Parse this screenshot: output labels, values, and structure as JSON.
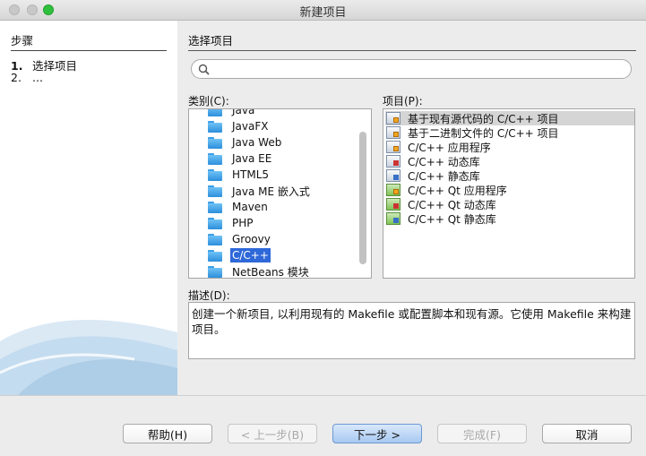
{
  "window": {
    "title": "新建项目"
  },
  "steps": {
    "header": "步骤",
    "items": [
      {
        "num": "1.",
        "label": "选择项目"
      },
      {
        "num": "2.",
        "label": "..."
      }
    ]
  },
  "main": {
    "header": "选择项目",
    "search": {
      "value": "",
      "placeholder": ""
    },
    "categories_label": "类别(C):",
    "projects_label": "项目(P):",
    "categories": [
      "Java",
      "JavaFX",
      "Java Web",
      "Java EE",
      "HTML5",
      "Java ME 嵌入式",
      "Maven",
      "PHP",
      "Groovy",
      "C/C++",
      "NetBeans 模块"
    ],
    "selected_category": "C/C++",
    "projects": [
      {
        "label": "基于现有源代码的 C/C++ 项目",
        "icon": "cpp-project-icon",
        "selected": true
      },
      {
        "label": "基于二进制文件的 C/C++ 项目",
        "icon": "cpp-project-icon"
      },
      {
        "label": "C/C++ 应用程序",
        "icon": "cpp-application-icon"
      },
      {
        "label": "C/C++ 动态库",
        "icon": "cpp-dynamic-library-icon"
      },
      {
        "label": "C/C++ 静态库",
        "icon": "cpp-static-library-icon"
      },
      {
        "label": "C/C++ Qt 应用程序",
        "icon": "qt-application-icon"
      },
      {
        "label": "C/C++ Qt 动态库",
        "icon": "qt-dynamic-library-icon"
      },
      {
        "label": "C/C++ Qt 静态库",
        "icon": "qt-static-library-icon"
      }
    ],
    "description_label": "描述(D):",
    "description": "创建一个新项目, 以利用现有的 Makefile 或配置脚本和现有源。它使用 Makefile 来构建项目。"
  },
  "buttons": {
    "help": "帮助(H)",
    "back": "< 上一步(B)",
    "next": "下一步 >",
    "finish": "完成(F)",
    "cancel": "取消"
  },
  "colors": {
    "selection": "#2e68d9",
    "folder": "#3c9ee6",
    "traffic_max": "#2fbf3c"
  }
}
